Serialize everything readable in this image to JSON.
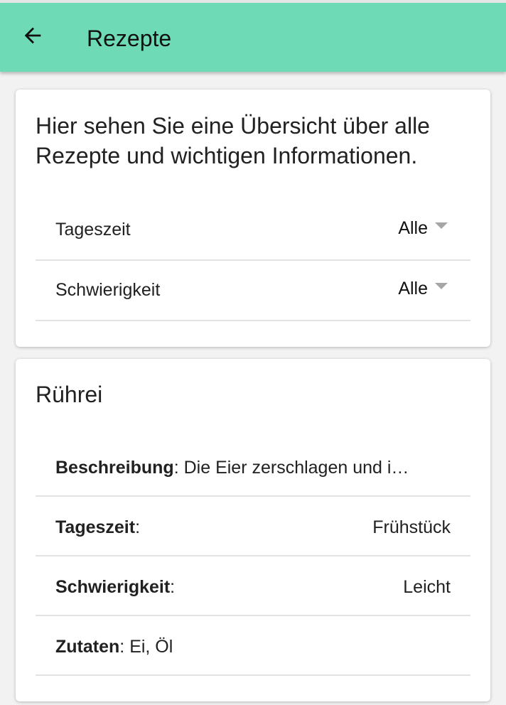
{
  "appbar": {
    "title": "Rezepte",
    "back_icon": "arrow-left-icon",
    "color": "#6fdbb6"
  },
  "filter_card": {
    "intro": "Hier sehen Sie eine Übersicht über alle Rezepte und wichtigen Informationen.",
    "filters": [
      {
        "label": "Tageszeit",
        "value": "Alle"
      },
      {
        "label": "Schwierigkeit",
        "value": "Alle"
      }
    ]
  },
  "recipe": {
    "title": "Rührei",
    "description_label": "Beschreibung",
    "description_value": "Die Eier zerschlagen und i…",
    "time_label": "Tageszeit",
    "time_value": "Frühstück",
    "difficulty_label": "Schwierigkeit",
    "difficulty_value": "Leicht",
    "ingredients_label": "Zutaten",
    "ingredients_value": "Ei, Öl",
    "separator": ":"
  }
}
